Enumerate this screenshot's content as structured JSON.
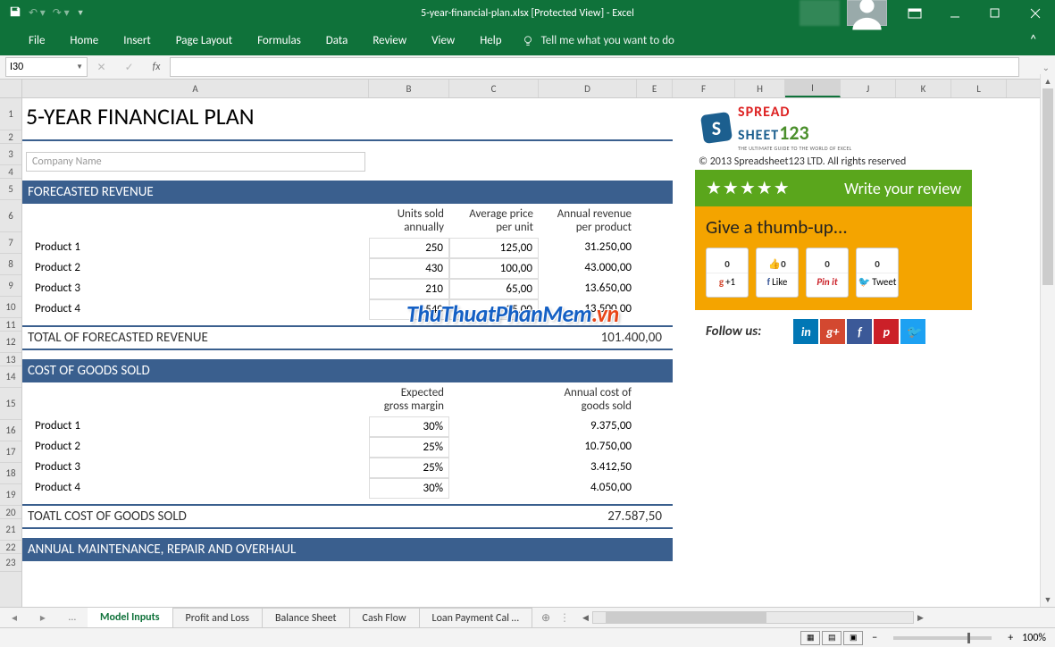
{
  "titlebar": {
    "title": "5-year-financial-plan.xlsx  [Protected View] - Excel"
  },
  "ribbon": {
    "tabs": [
      "File",
      "Home",
      "Insert",
      "Page Layout",
      "Formulas",
      "Data",
      "Review",
      "View",
      "Help"
    ],
    "tellme": "Tell me what you want to do"
  },
  "namebox": "I30",
  "columns": [
    "A",
    "B",
    "C",
    "D",
    "E",
    "F",
    "H",
    "I",
    "J",
    "K",
    "L"
  ],
  "sheet": {
    "title": "5-YEAR FINANCIAL PLAN",
    "company_placeholder": "Company Name",
    "forecast_header": "FORECASTED REVENUE",
    "headers": {
      "units": "Units sold annually",
      "avg": "Average price per unit",
      "annual": "Annual revenue per product"
    },
    "products_rev": [
      {
        "name": "Product 1",
        "units": "250",
        "price": "125,00",
        "rev": "31.250,00"
      },
      {
        "name": "Product 2",
        "units": "430",
        "price": "100,00",
        "rev": "43.000,00"
      },
      {
        "name": "Product 3",
        "units": "210",
        "price": "65,00",
        "rev": "13.650,00"
      },
      {
        "name": "Product 4",
        "units": "540",
        "price": "25,00",
        "rev": "13.500,00"
      }
    ],
    "total_rev_label": "TOTAL OF FORECASTED REVENUE",
    "total_rev_value": "101.400,00",
    "cogs_header": "COST OF GOODS SOLD",
    "cogs_h1": "Expected gross margin",
    "cogs_h2": "Annual cost of goods sold",
    "products_cogs": [
      {
        "name": "Product 1",
        "margin": "30%",
        "cost": "9.375,00"
      },
      {
        "name": "Product 2",
        "margin": "25%",
        "cost": "10.750,00"
      },
      {
        "name": "Product 3",
        "margin": "25%",
        "cost": "3.412,50"
      },
      {
        "name": "Product 4",
        "margin": "30%",
        "cost": "4.050,00"
      }
    ],
    "total_cogs_label": "TOATL COST OF GOODS SOLD",
    "total_cogs_value": "27.587,50",
    "maint_header": "ANNUAL MAINTENANCE, REPAIR AND OVERHAUL"
  },
  "side": {
    "logo_top": "SPREAD",
    "logo_bottom": "SHEET",
    "logo_num": "123",
    "logo_tag": "THE ULTIMATE GUIDE TO THE WORLD OF EXCEL",
    "copyright": "© 2013 Spreadsheet123 LTD. All rights reserved",
    "review": "Write your review",
    "thumb": "Give a thumb-up...",
    "g_plus": "+1",
    "g_count": "",
    "fb_count": "0",
    "fb_lbl": "Like",
    "pin_count": "0",
    "pin_lbl": "Pin it",
    "tw_count": "0",
    "tw_lbl": "Tweet",
    "follow": "Follow us:"
  },
  "ws_tabs": [
    "Model Inputs",
    "Profit and Loss",
    "Balance Sheet",
    "Cash Flow",
    "Loan Payment Cal …"
  ],
  "status": {
    "zoom": "100%"
  },
  "watermark": {
    "a": "ThuThuatPhanMem",
    "b": ".vn"
  }
}
